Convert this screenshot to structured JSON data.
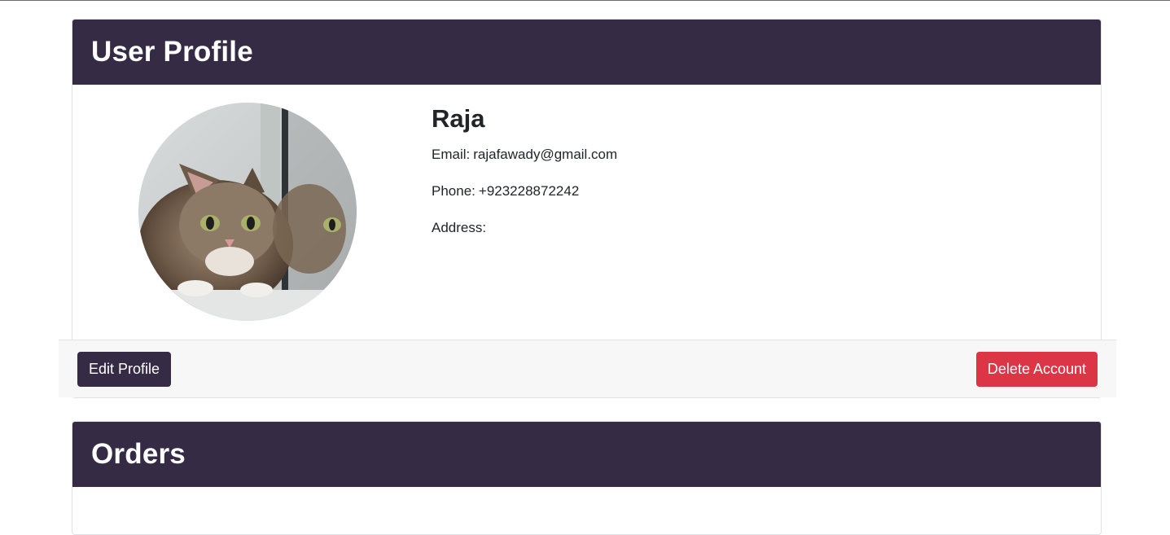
{
  "profile_card": {
    "title": "User Profile",
    "user": {
      "name": "Raja",
      "email_label": "Email:",
      "email": "rajafawady@gmail.com",
      "phone_label": "Phone:",
      "phone": "+923228872242",
      "address_label": "Address:",
      "address": ""
    },
    "avatar_icon": "kitten-photo",
    "actions": {
      "edit_label": "Edit Profile",
      "delete_label": "Delete Account"
    }
  },
  "orders_card": {
    "title": "Orders"
  },
  "colors": {
    "header_bg": "#352b45",
    "delete_btn": "#dc3545",
    "footer_bg": "#f7f7f7"
  }
}
